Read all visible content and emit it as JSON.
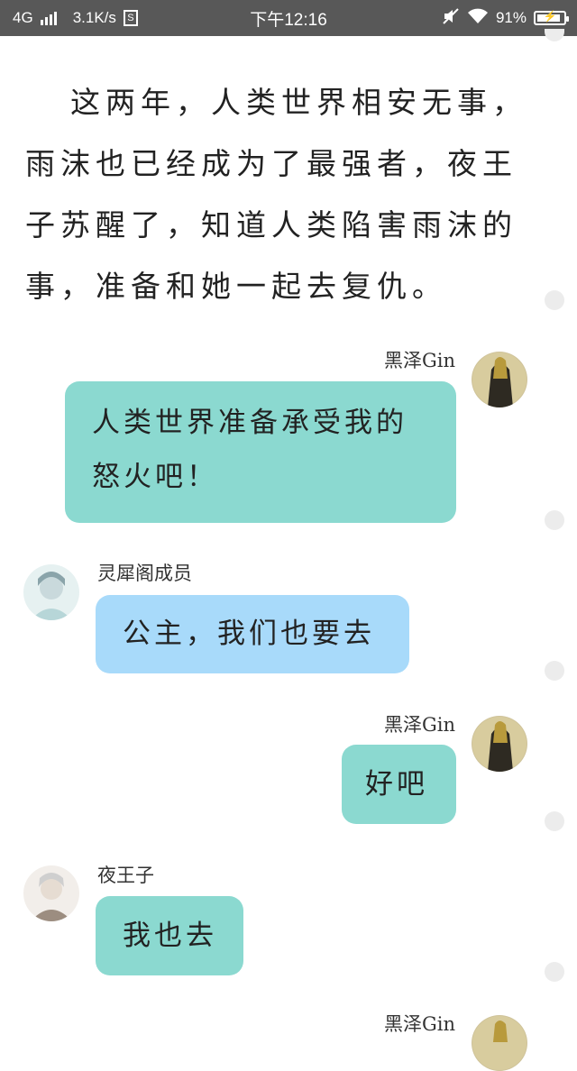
{
  "status_bar": {
    "network": "4G",
    "speed": "3.1K/s",
    "time": "下午12:16",
    "battery_percent": "91%",
    "battery_level": 0.91
  },
  "narrative": "这两年，人类世界相安无事，雨沫也已经成为了最强者，夜王子苏醒了，知道人类陷害雨沫的事，准备和她一起去复仇。",
  "messages": [
    {
      "sender": "黑泽Gin",
      "text": "人类世界准备承受我的怒火吧！",
      "side": "right",
      "color": "#8bd9d0"
    },
    {
      "sender": "灵犀阁成员",
      "text": "公主，我们也要去",
      "side": "left",
      "color": "#a8dafa"
    },
    {
      "sender": "黑泽Gin",
      "text": "好吧",
      "side": "right",
      "color": "#8bd9d0"
    },
    {
      "sender": "夜王子",
      "text": "我也去",
      "side": "left",
      "color": "#8bd9d0"
    },
    {
      "sender": "黑泽Gin",
      "text": "",
      "side": "right"
    }
  ]
}
